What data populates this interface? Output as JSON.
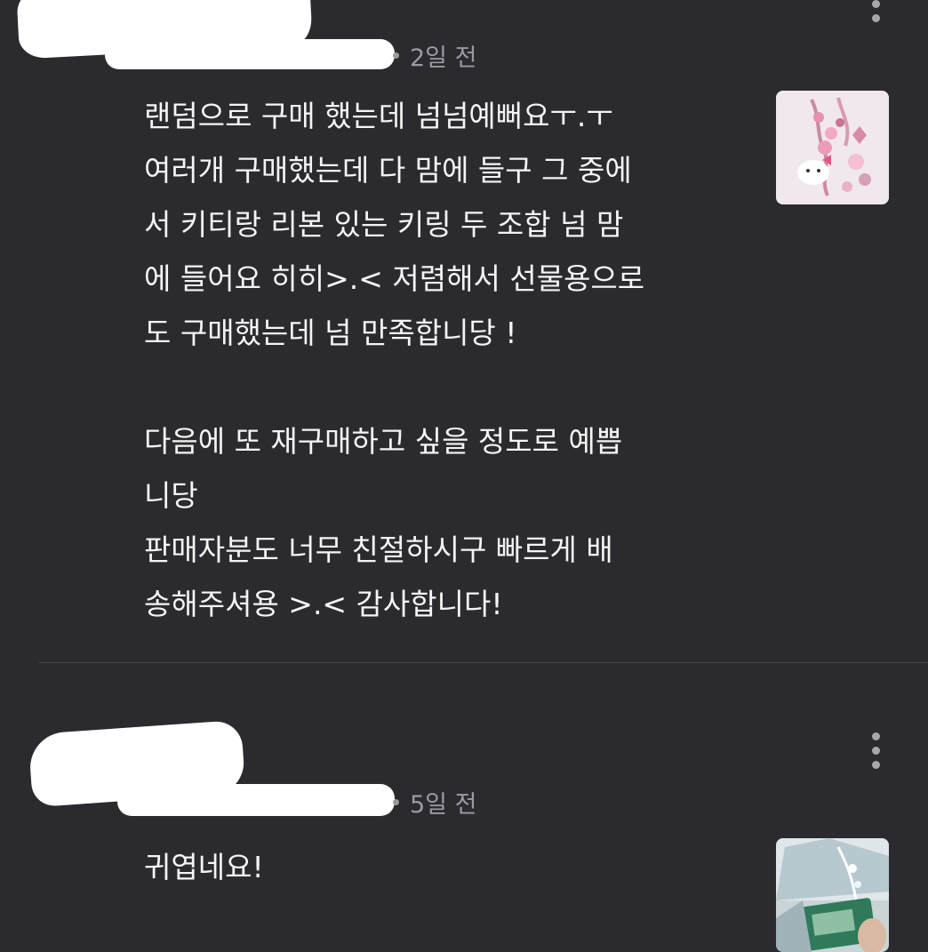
{
  "reviews": [
    {
      "date": "2일 전",
      "lines": [
        "랜덤으로 구매 했는데 넘넘예뻐요ㅜ.ㅜ",
        "여러개 구매했는데 다 맘에 들구 그 중에",
        "서 키티랑 리본 있는 키링 두 조합 넘 맘",
        "에 들어요 히히>.< 저렴해서 선물용으로",
        "도 구매했는데 넘 만족합니당 !",
        "",
        "다음에 또 재구매하고 싶을 정도로 예쁩",
        "니당",
        "판매자분도 너무 친절하시구 빠르게 배",
        "송해주셔용 >.< 감사합니다!"
      ],
      "photo_icon": "review-photo-keychain"
    },
    {
      "date": "5일 전",
      "lines": [
        "귀엽네요!"
      ],
      "photo_icon": "review-photo-product"
    }
  ],
  "colors": {
    "background": "#2b2b2f",
    "text": "#f4f4f4",
    "meta": "#9a9aa0",
    "divider": "#4a4a50"
  }
}
